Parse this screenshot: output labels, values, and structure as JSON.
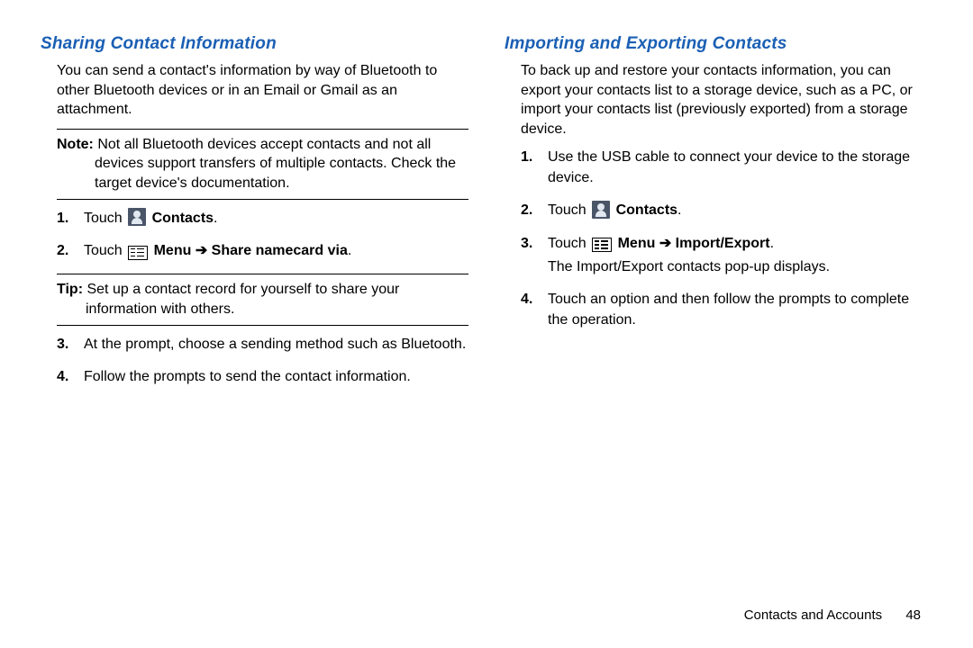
{
  "left": {
    "title": "Sharing Contact Information",
    "intro": "You can send a contact's information by way of Bluetooth to other Bluetooth devices or in an Email or Gmail as an attachment.",
    "note_label": "Note:",
    "note_body": "Not all Bluetooth devices accept contacts and not all devices support transfers of multiple contacts. Check the target device's documentation.",
    "step1_num": "1.",
    "step1_touch": "Touch ",
    "step1_contacts": "Contacts",
    "step2_num": "2.",
    "step2_touch": "Touch ",
    "step2_menu": "Menu",
    "step2_arrow": " ➔ ",
    "step2_share": "Share namecard via",
    "tip_label": "Tip:",
    "tip_body": "Set up a contact record for yourself to share your information with others.",
    "step3_num": "3.",
    "step3_text": "At the prompt, choose a sending method such as Bluetooth.",
    "step4_num": "4.",
    "step4_text": "Follow the prompts to send the contact information."
  },
  "right": {
    "title": "Importing and Exporting Contacts",
    "intro": "To back up and restore your contacts information, you can export your contacts list to a storage device, such as a PC, or import your contacts list (previously exported) from a storage device.",
    "step1_num": "1.",
    "step1_text": "Use the USB cable to connect your device to the storage device.",
    "step2_num": "2.",
    "step2_touch": "Touch ",
    "step2_contacts": "Contacts",
    "step3_num": "3.",
    "step3_touch": "Touch ",
    "step3_menu": "Menu",
    "step3_arrow": " ➔ ",
    "step3_import": "Import/Export",
    "step3_after": "The Import/Export contacts pop-up displays.",
    "step4_num": "4.",
    "step4_text": "Touch an option and then follow the prompts to complete the operation."
  },
  "footer": {
    "section": "Contacts and Accounts",
    "page": "48"
  },
  "period": "."
}
